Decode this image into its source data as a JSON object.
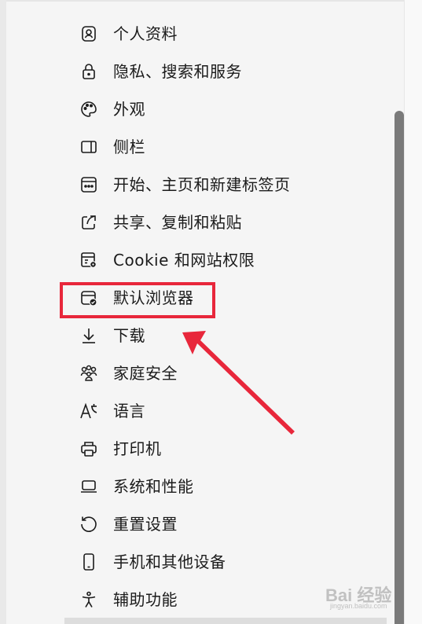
{
  "nav": {
    "items": [
      {
        "label": "个人资料",
        "icon": "profile-icon"
      },
      {
        "label": "隐私、搜索和服务",
        "icon": "lock-icon"
      },
      {
        "label": "外观",
        "icon": "palette-icon"
      },
      {
        "label": "侧栏",
        "icon": "sidebar-icon"
      },
      {
        "label": "开始、主页和新建标签页",
        "icon": "start-home-icon"
      },
      {
        "label": "共享、复制和粘贴",
        "icon": "share-icon"
      },
      {
        "label": "Cookie 和网站权限",
        "icon": "site-permissions-icon"
      },
      {
        "label": "默认浏览器",
        "icon": "default-browser-icon"
      },
      {
        "label": "下载",
        "icon": "download-icon"
      },
      {
        "label": "家庭安全",
        "icon": "family-icon"
      },
      {
        "label": "语言",
        "icon": "language-icon"
      },
      {
        "label": "打印机",
        "icon": "printer-icon"
      },
      {
        "label": "系统和性能",
        "icon": "laptop-icon"
      },
      {
        "label": "重置设置",
        "icon": "reset-icon"
      },
      {
        "label": "手机和其他设备",
        "icon": "phone-icon"
      },
      {
        "label": "辅助功能",
        "icon": "accessibility-icon"
      }
    ]
  },
  "annotation": {
    "highlight_color": "#e8273b",
    "highlighted_item": "默认浏览器"
  },
  "watermark": {
    "main": "Bai 经验",
    "sub": "jingyan.baidu.com"
  }
}
